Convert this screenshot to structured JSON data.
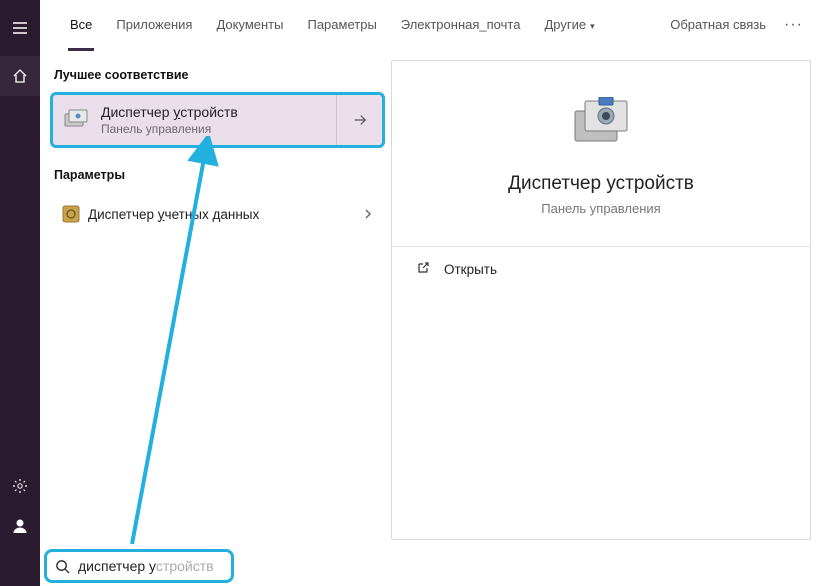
{
  "sidebar": {
    "items": [
      "menu",
      "home",
      "settings",
      "user"
    ]
  },
  "tabs": {
    "items": [
      {
        "label": "Все",
        "active": true
      },
      {
        "label": "Приложения"
      },
      {
        "label": "Документы"
      },
      {
        "label": "Параметры"
      },
      {
        "label": "Электронная_почта"
      },
      {
        "label": "Другие",
        "dropdown": true
      }
    ],
    "feedback": "Обратная связь"
  },
  "sections": {
    "best_match": "Лучшее соответствие",
    "settings": "Параметры"
  },
  "best_match": {
    "title_normal": "Диспетчер ",
    "title_ul": "у",
    "title_rest": "стройств",
    "subtitle": "Панель управления"
  },
  "settings_result": {
    "title_normal": "Диспетчер ",
    "title_ul": "у",
    "title_rest": "четных данных"
  },
  "preview": {
    "title": "Диспетчер устройств",
    "subtitle": "Панель управления",
    "open_label": "Открыть"
  },
  "search": {
    "typed": "диспетчер у",
    "hint": "стройств"
  }
}
